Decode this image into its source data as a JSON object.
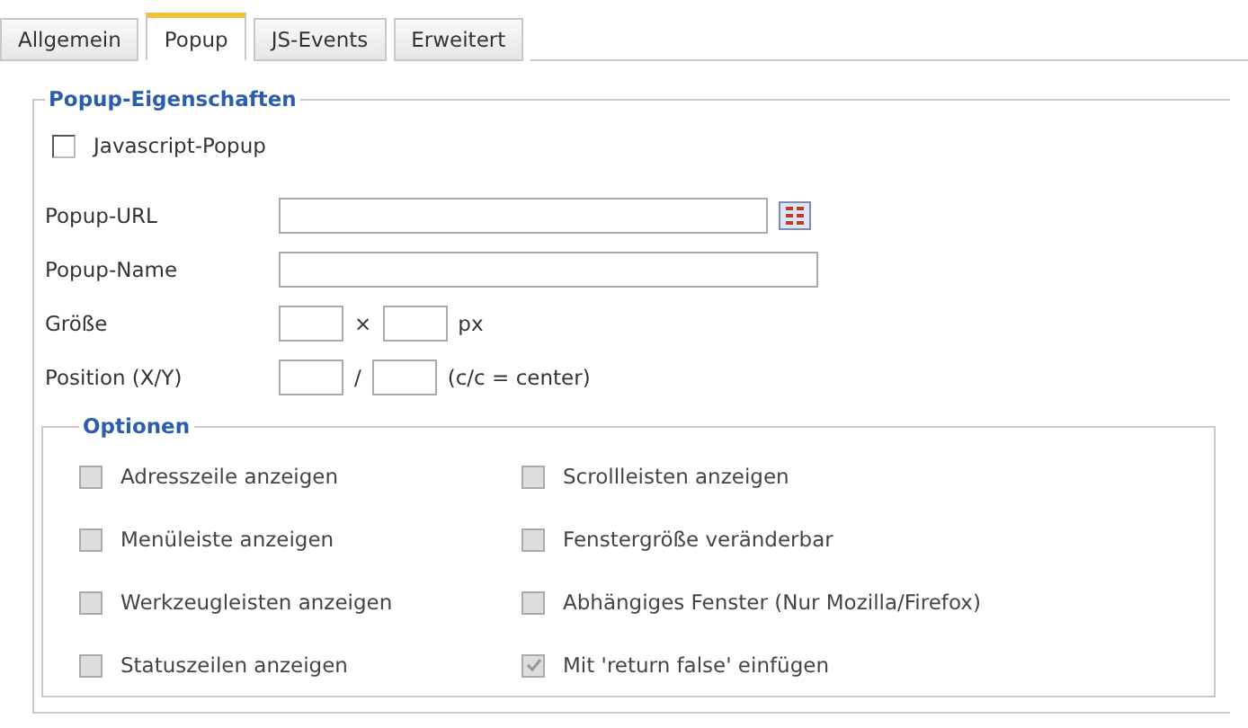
{
  "tabs": [
    {
      "label": "Allgemein",
      "selected": false
    },
    {
      "label": "Popup",
      "selected": true
    },
    {
      "label": "JS-Events",
      "selected": false
    },
    {
      "label": "Erweitert",
      "selected": false
    }
  ],
  "popup_properties": {
    "legend": "Popup-Eigenschaften",
    "javascript_popup": {
      "label": "Javascript-Popup",
      "checked": false
    },
    "url": {
      "label": "Popup-URL"
    },
    "name": {
      "label": "Popup-Name"
    },
    "size": {
      "label": "Größe",
      "separator": "×",
      "unit": "px"
    },
    "position": {
      "label": "Position (X/Y)",
      "separator": "/",
      "hint": "(c/c = center)"
    }
  },
  "options": {
    "legend": "Optionen",
    "items": [
      {
        "label": "Adresszeile anzeigen",
        "checked": false,
        "disabled": true
      },
      {
        "label": "Scrollleisten anzeigen",
        "checked": false,
        "disabled": true
      },
      {
        "label": "Menüleiste anzeigen",
        "checked": false,
        "disabled": true
      },
      {
        "label": "Fenstergröße veränderbar",
        "checked": false,
        "disabled": true
      },
      {
        "label": "Werkzeugleisten anzeigen",
        "checked": false,
        "disabled": true
      },
      {
        "label": "Abhängiges Fenster (Nur Mozilla/Firefox)",
        "checked": false,
        "disabled": true
      },
      {
        "label": "Statuszeilen anzeigen",
        "checked": false,
        "disabled": true
      },
      {
        "label": "Mit 'return false' einfügen",
        "checked": true,
        "disabled": true
      }
    ]
  }
}
